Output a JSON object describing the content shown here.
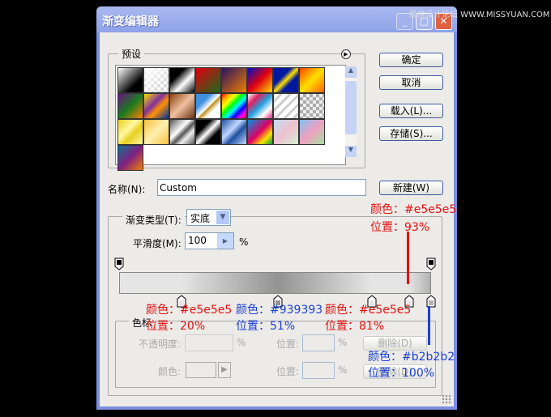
{
  "window": {
    "title": "渐变编辑器",
    "minimize": "_",
    "maximize": "□",
    "close": "✕"
  },
  "watermark": "思缘设计论坛 WWW.MISSYUAN.COM",
  "presets": {
    "label": "预设",
    "menu_icon": "circle-arrow-right-icon",
    "swatches": [
      "linear-gradient(135deg,#fff,#000 70%)",
      "linear-gradient(135deg,#fff,rgba(255,255,255,0)),repeating-conic-gradient(#ccc 0 25%,#fff 0 50%) 0 0/8px 8px",
      "linear-gradient(135deg,#000 30%,#fff 60%,#000)",
      "linear-gradient(135deg,#e00010,#1a6a1a)",
      "linear-gradient(135deg,#2a1060,#f08000)",
      "linear-gradient(135deg,#0010c0,#e00010 50%,#ffe000)",
      "linear-gradient(135deg,#0018a0 35%,#ffe000 50%,#0018a0 65%)",
      "linear-gradient(135deg,#ff4000,#ffe000 50%,#ff6000)",
      "linear-gradient(135deg,#6a1080,#1a7a20 50%,#ff8000)",
      "linear-gradient(135deg,#ffe000,#8030a0 40%,#ff9000 60%,#0030a0)",
      "linear-gradient(135deg,#8a4010,#f0c0a0 50%,#6a3010)",
      "linear-gradient(135deg,#4090e0 30%,#fff 50%,#c09020 55%,#fff 70%)",
      "linear-gradient(135deg,red,orange,yellow,lime,cyan,blue,magenta,red)",
      "linear-gradient(135deg,#fff,#e02060,#20a0e0,#fff,#e02080)",
      "repeating-linear-gradient(135deg,#fff 0 5px,#ccc 5px 8px)",
      "repeating-conic-gradient(#aaa 0 25%,#eee 0 50%) 0 0/8px 8px",
      "linear-gradient(135deg,#e8d020,#fff8a0 40%,#e8d020 60%,#fff8a0)",
      "linear-gradient(135deg,#f8c040,#fff0b0 50%,#f8c040)",
      "linear-gradient(135deg,#555,#fff 40%,#555 55%,#eee 70%,#555)",
      "linear-gradient(135deg,#000 30%,#fff 50%,#000 70%)",
      "linear-gradient(135deg,#2050a0,#c0d8ff 40%,#2050a0 60%,#c0d8ff)",
      "linear-gradient(135deg,#0090e0,#e00060 50%,#ffe000,#00a040)",
      "linear-gradient(135deg,#c0e0f0,#f0c0d0 50%,#d0f0d0)",
      "linear-gradient(135deg,#80c0f0,#f0a0c0 50%,#a0e0a0)",
      "linear-gradient(135deg,#107090,#802080 50%,#f08000)"
    ]
  },
  "buttons": {
    "ok": "确定",
    "cancel": "取消",
    "load": "载入(L)...",
    "save": "存储(S)...",
    "new": "新建(W)"
  },
  "name": {
    "label": "名称(N):",
    "value": "Custom"
  },
  "gradient_type": {
    "label": "渐变类型(T):",
    "value": "实底"
  },
  "smoothness": {
    "label": "平滑度(M):",
    "value": "100",
    "unit": "%"
  },
  "gradient": {
    "opacity_stops": [
      0,
      100
    ],
    "color_stops": [
      {
        "pos": 20,
        "color": "#e5e5e5"
      },
      {
        "pos": 51,
        "color": "#939393"
      },
      {
        "pos": 81,
        "color": "#e5e5e5"
      },
      {
        "pos": 93,
        "color": "#e5e5e5"
      },
      {
        "pos": 100,
        "color": "#b2b2b2"
      }
    ]
  },
  "stops_group": {
    "label": "色标",
    "opacity_label": "不透明度:",
    "opacity_unit": "%",
    "position_label": "位置:",
    "position_unit": "%",
    "delete": "删除(D)",
    "color_label": "颜色:"
  },
  "annotations": {
    "a93": {
      "color": "颜色：#e5e5e5",
      "pos": "位置：93%"
    },
    "a20": {
      "color": "颜色：#e5e5e5",
      "pos": "位置：20%"
    },
    "a51": {
      "color": "颜色：#939393",
      "pos": "位置：51%"
    },
    "a81": {
      "color": "颜色：#e5e5e5",
      "pos": "位置：81%"
    },
    "a100": {
      "color": "颜色：#b2b2b2",
      "pos": "位置：100%"
    },
    "red": "#e41010",
    "blue": "#1a3fd6"
  }
}
